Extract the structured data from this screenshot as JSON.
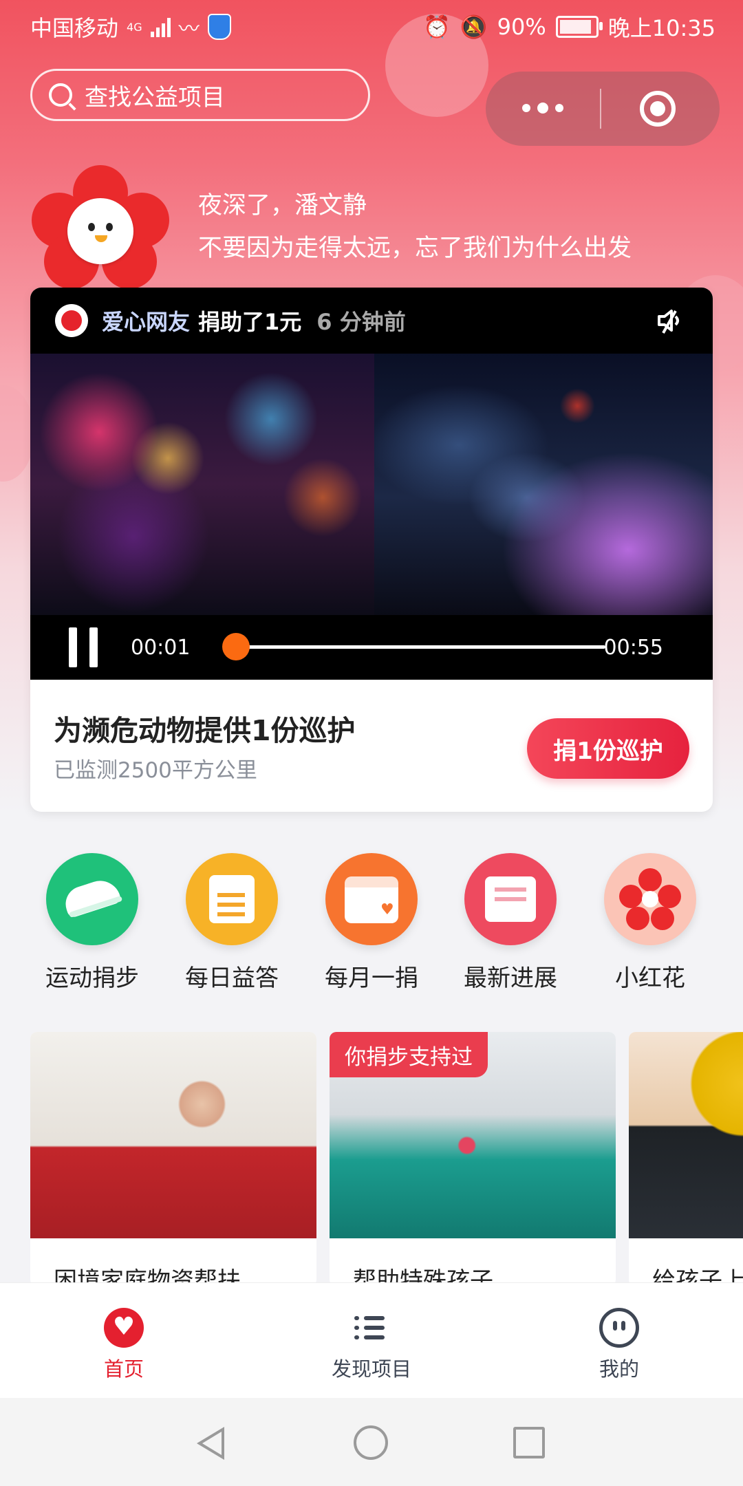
{
  "status_bar": {
    "carrier": "中国移动",
    "network": "4G",
    "battery": "90%",
    "time": "晚上10:35"
  },
  "search": {
    "placeholder": "查找公益项目"
  },
  "greeting": {
    "line1": "夜深了，潘文静",
    "line2": "不要因为走得太远，忘了我们为什么出发"
  },
  "video": {
    "donor_name": "爱心网友",
    "donor_action": "捐助了1元",
    "donor_time": "6 分钟前",
    "time_current": "00:01",
    "time_total": "00:55",
    "progress_fraction": 0.02
  },
  "feature_card": {
    "title": "为濒危动物提供1份巡护",
    "subtitle": "已监测2500平方公里",
    "button": "捐1份巡护"
  },
  "quick_actions": [
    {
      "label": "运动捐步",
      "icon": "sneaker-icon",
      "color": "#1fc17a"
    },
    {
      "label": "每日益答",
      "icon": "notepad-icon",
      "color": "#f7b227"
    },
    {
      "label": "每月一捐",
      "icon": "calendar-icon",
      "color": "#f7742f"
    },
    {
      "label": "最新进展",
      "icon": "inbox-icon",
      "color": "#ee4a5f"
    },
    {
      "label": "小红花",
      "icon": "red-flower-icon",
      "color": "#fbc4b6"
    }
  ],
  "projects": [
    {
      "title": "困境家庭物资帮扶",
      "badge": ""
    },
    {
      "title": "帮助特殊孩子",
      "badge": "你捐步支持过"
    },
    {
      "title": "给孩子上"
    }
  ],
  "tab_bar": {
    "items": [
      {
        "label": "首页",
        "icon": "home-heart-icon",
        "active": true
      },
      {
        "label": "发现项目",
        "icon": "list-icon",
        "active": false
      },
      {
        "label": "我的",
        "icon": "smiley-profile-icon",
        "active": false
      }
    ],
    "active_color": "#e4202f"
  }
}
